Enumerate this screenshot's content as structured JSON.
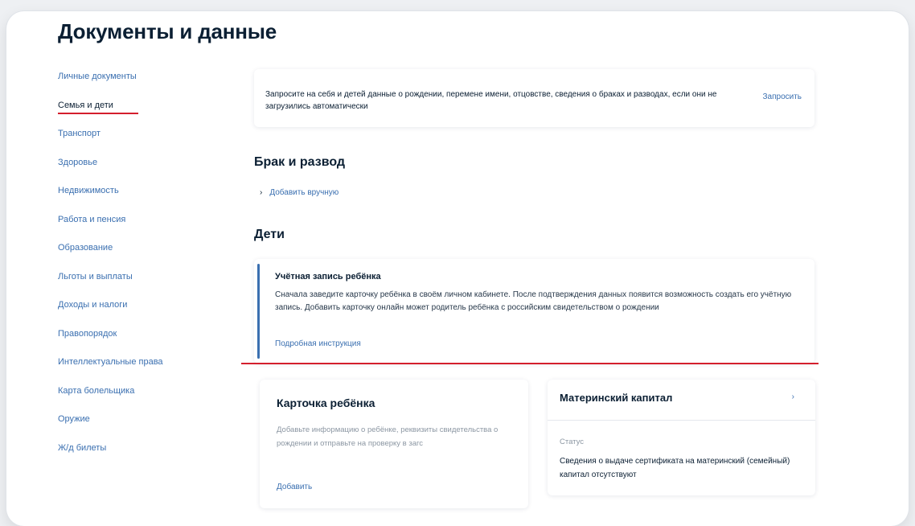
{
  "page": {
    "title": "Документы и данные"
  },
  "sidebar": {
    "items": [
      {
        "label": "Личные документы"
      },
      {
        "label": "Семья и дети"
      },
      {
        "label": "Транспорт"
      },
      {
        "label": "Здоровье"
      },
      {
        "label": "Недвижимость"
      },
      {
        "label": "Работа и пенсия"
      },
      {
        "label": "Образование"
      },
      {
        "label": "Льготы и выплаты"
      },
      {
        "label": "Доходы и налоги"
      },
      {
        "label": "Правопорядок"
      },
      {
        "label": "Интеллектуальные права"
      },
      {
        "label": "Карта болельщика"
      },
      {
        "label": "Оружие"
      },
      {
        "label": "Ж/д билеты"
      }
    ],
    "active_index": 1
  },
  "request_card": {
    "text": "Запросите на себя и детей данные о рождении, перемене имени, отцовстве, сведения о браках и разводах, если они не загрузились автоматически",
    "button": "Запросить"
  },
  "marriage": {
    "title": "Брак и развод",
    "add_manual": "Добавить вручную",
    "chevron": "›"
  },
  "children": {
    "title": "Дети",
    "account_card": {
      "title": "Учётная запись ребёнка",
      "body": "Сначала заведите карточку ребёнка в своём личном кабинете. После подтверждения данных появится возможность создать его учётную запись. Добавить карточку онлайн может родитель ребёнка с российским свидетельством о рождении",
      "link": "Подробная инструкция"
    },
    "child_card": {
      "title": "Карточка ребёнка",
      "description": "Добавьте информацию о ребёнке, реквизиты свидетельства о рождении и отправьте на проверку в загс",
      "add": "Добавить"
    },
    "maternity_card": {
      "title": "Материнский капитал",
      "chevron": "›",
      "status_label": "Статус",
      "status_value": "Сведения о выдаче сертификата на материнский (семейный) капитал отсутствуют"
    }
  },
  "colors": {
    "link": "#3a6fb0",
    "text": "#0b1f33",
    "annotation": "#d41f2d",
    "muted": "#8c97a3"
  }
}
